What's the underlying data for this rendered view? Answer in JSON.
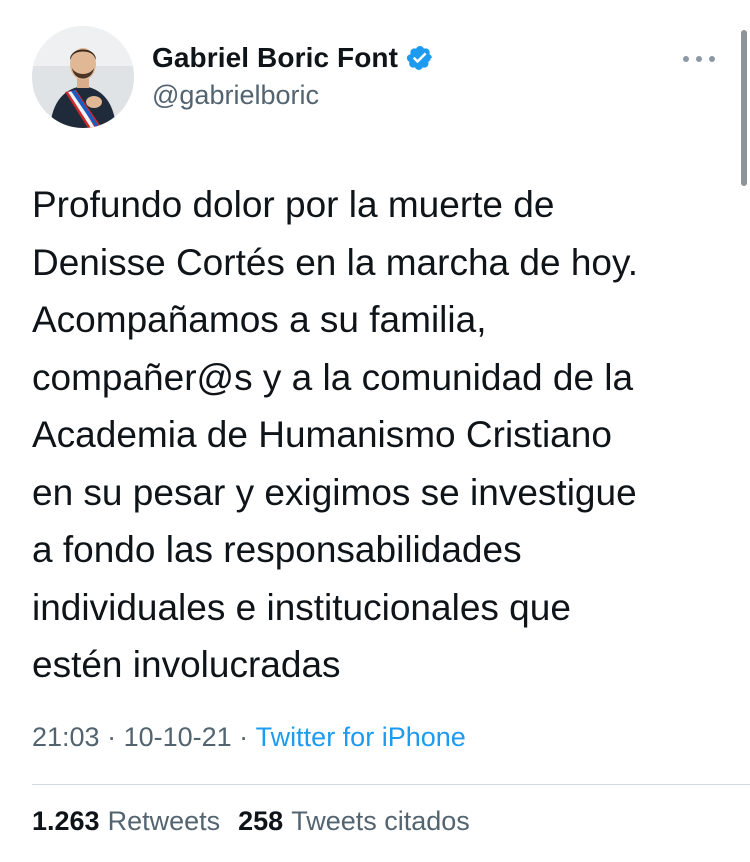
{
  "author": {
    "name": "Gabriel Boric Font",
    "handle": "@gabrielboric",
    "verified": true
  },
  "tweet": {
    "text": "Profundo dolor por la muerte de\nDenisse Cortés en la marcha de hoy.\nAcompañamos a su familia,\ncompañer@s y a la comunidad de la\nAcademia de Humanismo Cristiano\nen su pesar y exigimos se investigue\na fondo las responsabilidades\nindividuales e institucionales que\nestén involucradas"
  },
  "meta": {
    "time": "21:03",
    "separator1": " · ",
    "date": "10-10-21",
    "separator2": " · ",
    "source": "Twitter for iPhone"
  },
  "stats": {
    "retweets_count": "1.263",
    "retweets_label": "Retweets",
    "quotes_count": "258",
    "quotes_label": "Tweets citados"
  },
  "colors": {
    "accent": "#1d9bf0",
    "text": "#0f1419",
    "secondary": "#536471"
  },
  "icons": {
    "verified": "verified-badge-icon",
    "more": "more-options-icon"
  }
}
